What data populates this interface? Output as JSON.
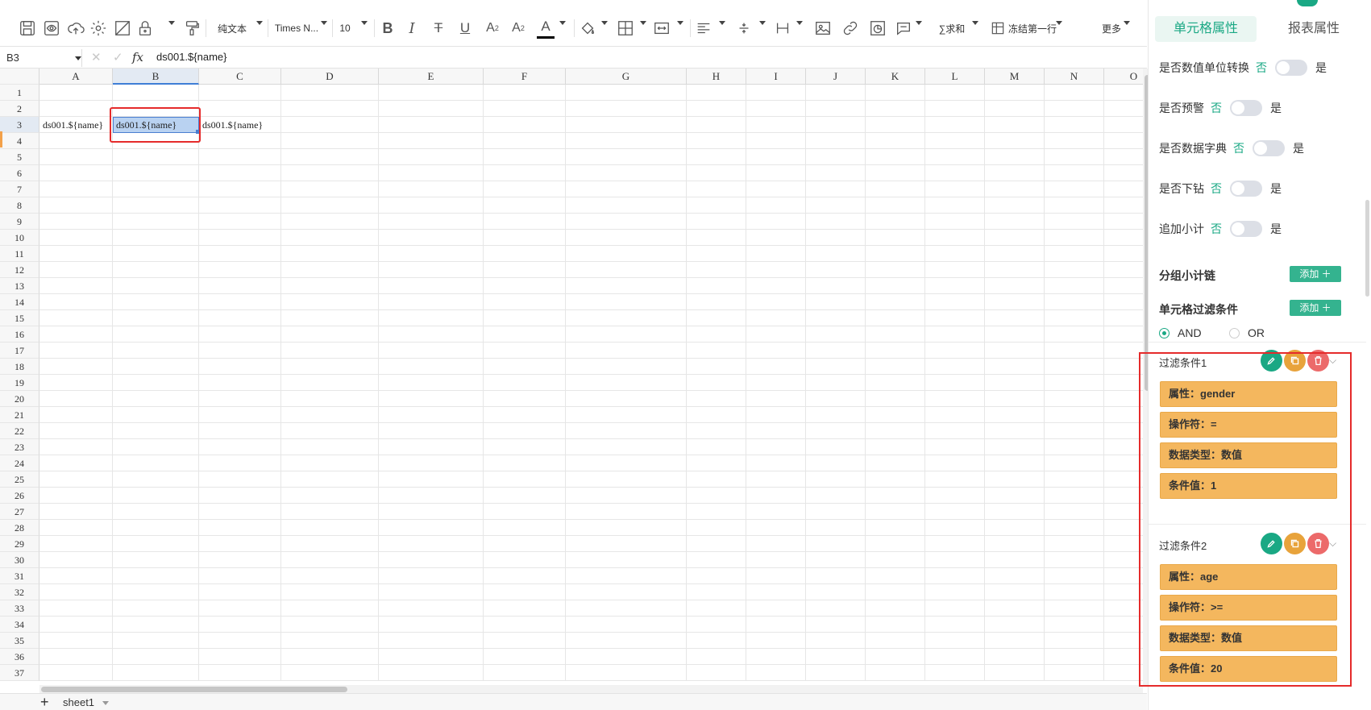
{
  "toolbar": {
    "text_format": "纯文本",
    "font_name": "Times N...",
    "font_size": "10",
    "sum_label": "∑求和",
    "freeze_label": "冻结第一行",
    "more_label": "更多"
  },
  "formula_bar": {
    "cell_ref": "B3",
    "fx": "fx",
    "formula": "ds001.${name}"
  },
  "grid": {
    "columns": [
      "A",
      "B",
      "C",
      "D",
      "E",
      "F",
      "G",
      "H",
      "I",
      "J",
      "K",
      "L",
      "M",
      "N",
      "O"
    ],
    "rows": [
      "1",
      "2",
      "3",
      "4",
      "5",
      "6",
      "7",
      "8",
      "9",
      "10",
      "11",
      "12",
      "13",
      "14",
      "15",
      "16",
      "17",
      "18",
      "19",
      "20",
      "21",
      "22",
      "23",
      "24",
      "25",
      "26",
      "27",
      "28",
      "29",
      "30",
      "31",
      "32",
      "33",
      "34",
      "35",
      "36",
      "37"
    ],
    "cells": {
      "A3": "ds001.${name}",
      "B3": "ds001.${name}",
      "C3": "ds001.${name}"
    }
  },
  "sheet": {
    "add": "+",
    "tab_name": "sheet1"
  },
  "panel": {
    "tabs": [
      "单元格属性",
      "报表属性"
    ],
    "toggles": [
      {
        "label": "是否数值单位转换",
        "off": "否",
        "on": "是"
      },
      {
        "label": "是否预警",
        "off": "否",
        "on": "是"
      },
      {
        "label": "是否数据字典",
        "off": "否",
        "on": "是"
      },
      {
        "label": "是否下钻",
        "off": "否",
        "on": "是"
      },
      {
        "label": "追加小计",
        "off": "否",
        "on": "是"
      }
    ],
    "group_subtotal_label": "分组小计链",
    "filter_label": "单元格过滤条件",
    "add_label": "添加 ＋",
    "logic_and": "AND",
    "logic_or": "OR",
    "conditions": [
      {
        "title": "过滤条件1",
        "items": [
          "属性：gender",
          "操作符：=",
          "数据类型：数值",
          "条件值：1"
        ]
      },
      {
        "title": "过滤条件2",
        "items": [
          "属性：age",
          "操作符：>=",
          "数据类型：数值",
          "条件值：20"
        ]
      }
    ]
  },
  "colors": {
    "accent": "#1aa884",
    "highlight": "#e52b2b",
    "condition_fill": "#f4b75e",
    "copy_btn": "#e8a33b",
    "delete_btn": "#ec6a6a"
  }
}
